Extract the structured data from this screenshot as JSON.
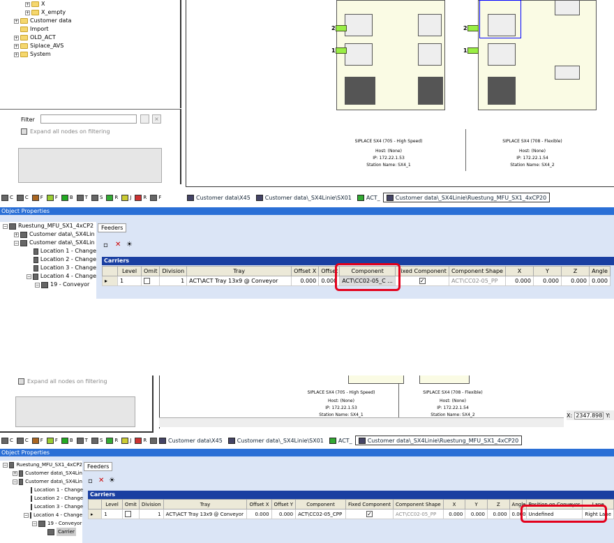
{
  "top": {
    "tree_items": [
      {
        "label": "X",
        "indent": 3
      },
      {
        "label": "X_empty",
        "indent": 3
      },
      {
        "label": "Customer data",
        "indent": 2
      },
      {
        "label": "Import",
        "indent": 2
      },
      {
        "label": "OLD_ACT",
        "indent": 2
      },
      {
        "label": "Siplace_AVS",
        "indent": 2
      },
      {
        "label": "System",
        "indent": 2
      }
    ],
    "filter_label": "Filter",
    "expand_label": "Expand all nodes on filtering",
    "bottom_tabs": [
      "C",
      "C",
      "F",
      "F",
      "B",
      "T",
      "S",
      "R",
      "J",
      "R",
      "F"
    ],
    "doc_tabs": [
      "Customer data\\X45",
      "Customer data\\_SX4Linie\\SX01",
      "ACT_",
      "Customer data\\_SX4Linie\\Ruestung_MFU_SX1_4xCP20"
    ],
    "stations": [
      {
        "title": "SIPLACE SX4 (705 - High Speed)",
        "host": "Host: (None)",
        "ip": "IP: 172.22.1.53",
        "name": "Station Name: SX4_1"
      },
      {
        "title": "SIPLACE SX4 (708 - Flexible)",
        "host": "Host: (None)",
        "ip": "IP: 172.22.1.54",
        "name": "Station Name: SX4_2"
      }
    ],
    "lane_arrows": [
      "2",
      "1",
      "2",
      "1"
    ],
    "object_properties_label": "Object Properties",
    "obj_tree": [
      "Ruestung_MFU_SX1_4xCP2",
      "Customer data\\_SX4Lin",
      "Customer data\\_SX4Lin",
      "Location 1 - Change",
      "Location 2 - Change",
      "Location 3 - Change",
      "Location 4 - Change",
      "19 - Conveyor"
    ],
    "feeders_tab": "Feeders",
    "carriers_label": "Carriers",
    "columns": [
      "Level",
      "Omit",
      "Division",
      "Tray",
      "Offset X",
      "Offset Y",
      "Component",
      "Fixed Component",
      "Component Shape",
      "X",
      "Y",
      "Z",
      "Angle"
    ],
    "row": {
      "level": "1",
      "division": "1",
      "tray": "ACT\\ACT Tray 13x9 @ Conveyor",
      "offx": "0.000",
      "offy": "0.000",
      "component": "ACT\\CC02-05_C",
      "shape": "ACT\\CC02-05_PP",
      "x": "0.000",
      "y": "0.000",
      "z": "0.000",
      "angle": "0.000"
    }
  },
  "bottom": {
    "expand_label": "Expand all nodes on filtering",
    "stations": [
      {
        "title": "SIPLACE SX4 (705 - High Speed)",
        "host": "Host: (None)",
        "ip": "IP: 172.22.1.53",
        "name": "Station Name: SX4_1"
      },
      {
        "title": "SIPLACE SX4 (708 - Flexible)",
        "host": "Host: (None)",
        "ip": "IP: 172.22.1.54",
        "name": "Station Name: SX4_2"
      }
    ],
    "coord_x_label": "X:",
    "coord_x_value": "2347.898",
    "coord_y_label": "Y:",
    "bottom_tabs": [
      "C",
      "C",
      "F",
      "F",
      "B",
      "T",
      "S",
      "R",
      "J",
      "R",
      "F"
    ],
    "doc_tabs": [
      "Customer data\\X45",
      "Customer data\\_SX4Linie\\SX01",
      "ACT_",
      "Customer data\\_SX4Linie\\Ruestung_MFU_SX1_4xCP20"
    ],
    "object_properties_label": "Object Properties",
    "obj_tree": [
      "Ruestung_MFU_SX1_4xCP2",
      "Customer data\\_SX4Lin",
      "Customer data\\_SX4Lin",
      "Location 1 - Change",
      "Location 2 - Change",
      "Location 3 - Change",
      "Location 4 - Change",
      "19 - Conveyor",
      "Carrier"
    ],
    "feeders_tab": "Feeders",
    "carriers_label": "Carriers",
    "columns": [
      "Level",
      "Omit",
      "Division",
      "Tray",
      "Offset X",
      "Offset Y",
      "Component",
      "Fixed Component",
      "Component Shape",
      "X",
      "Y",
      "Z",
      "Angle",
      "Position on Conveyor",
      "Lane"
    ],
    "row": {
      "level": "1",
      "division": "1",
      "tray": "ACT\\ACT Tray 13x9 @ Conveyor",
      "offx": "0.000",
      "offy": "0.000",
      "component": "ACT\\CC02-05_CPP",
      "shape": "ACT\\CC02-05_PP",
      "x": "0.000",
      "y": "0.000",
      "z": "0.000",
      "angle": "0.000",
      "position": "Undefined",
      "lane": "Right Lane"
    }
  }
}
